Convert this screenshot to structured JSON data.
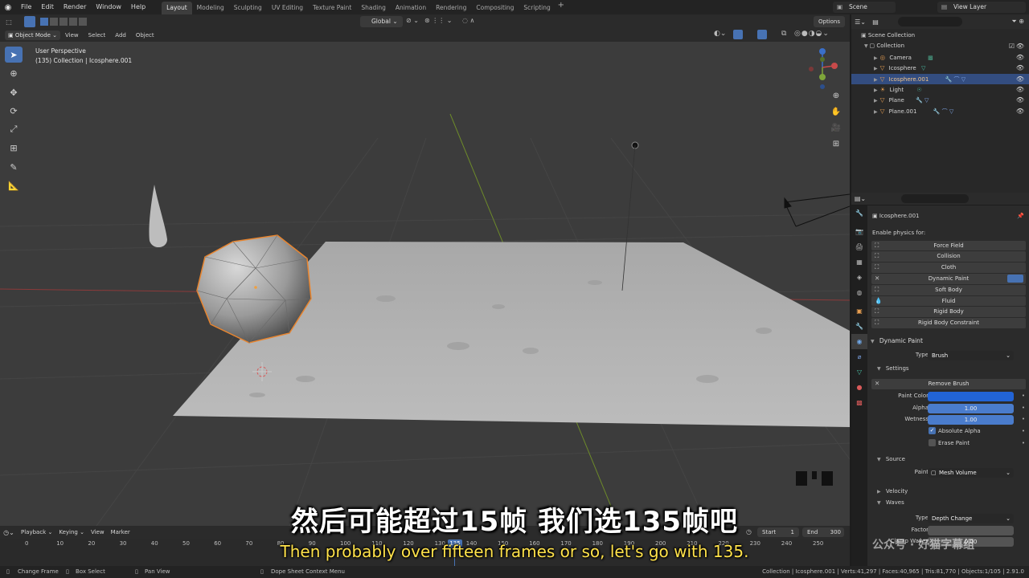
{
  "topbar": {
    "menus": [
      "File",
      "Edit",
      "Render",
      "Window",
      "Help"
    ],
    "workspaces": [
      "Layout",
      "Modeling",
      "Sculpting",
      "UV Editing",
      "Texture Paint",
      "Shading",
      "Animation",
      "Rendering",
      "Compositing",
      "Scripting"
    ],
    "active_workspace": "Layout",
    "scene": "Scene",
    "view_layer": "View Layer"
  },
  "viewport_header": {
    "mode": "Object Mode",
    "menus": [
      "View",
      "Select",
      "Add",
      "Object"
    ],
    "orientation": "Global",
    "options": "Options"
  },
  "viewport": {
    "view_name": "User Perspective",
    "context": "(135) Collection | Icosphere.001"
  },
  "outliner": {
    "root": "Scene Collection",
    "collection": "Collection",
    "items": [
      {
        "name": "Camera",
        "selected": false
      },
      {
        "name": "Icosphere",
        "selected": false
      },
      {
        "name": "Icosphere.001",
        "selected": true
      },
      {
        "name": "Light",
        "selected": false
      },
      {
        "name": "Plane",
        "selected": false
      },
      {
        "name": "Plane.001",
        "selected": false
      }
    ]
  },
  "properties": {
    "object_name": "Icosphere.001",
    "enable_physics_label": "Enable physics for:",
    "physics_buttons": [
      "Force Field",
      "Collision",
      "Cloth",
      "Dynamic Paint",
      "Soft Body",
      "Fluid",
      "Rigid Body",
      "Rigid Body Constraint"
    ],
    "dynamic_paint": {
      "title": "Dynamic Paint",
      "type_label": "Type",
      "type_value": "Brush",
      "settings_title": "Settings",
      "remove_brush": "Remove Brush",
      "paint_color_label": "Paint Color",
      "paint_color": "#2264d6",
      "alpha_label": "Alpha",
      "alpha_value": "1.00",
      "wetness_label": "Wetness",
      "wetness_value": "1.00",
      "absolute_alpha": "Absolute Alpha",
      "erase_paint": "Erase Paint",
      "source_title": "Source",
      "paint_label": "Paint",
      "paint_value": "Mesh Volume",
      "velocity_title": "Velocity",
      "waves_title": "Waves",
      "waves_type_label": "Type",
      "waves_type_value": "Depth Change",
      "factor_label": "Factor",
      "clamp_label": "Clamp Waves",
      "clamp_value": "0.00"
    }
  },
  "timeline": {
    "menus": [
      "Playback",
      "Keying",
      "View",
      "Marker"
    ],
    "start_label": "Start",
    "start_value": "1",
    "end_label": "End",
    "end_value": "300",
    "ticks": [
      "0",
      "10",
      "20",
      "30",
      "40",
      "50",
      "60",
      "70",
      "80",
      "90",
      "100",
      "110",
      "120",
      "130",
      "140",
      "150",
      "160",
      "170",
      "180",
      "190",
      "200",
      "210",
      "220",
      "230",
      "240",
      "250"
    ],
    "current_frame": "135"
  },
  "statusbar": {
    "change_frame": "Change Frame",
    "box_select": "Box Select",
    "pan_view": "Pan View",
    "context_menu": "Dope Sheet Context Menu",
    "stats": "Collection | Icosphere.001 | Verts:41,297 | Faces:40,965 | Tris:81,770 | Objects:1/105 | 2.91.0"
  },
  "subtitles": {
    "chinese": "然后可能超过15帧 我们选135帧吧",
    "english": "Then probably over fifteen frames or so, let's go with 135."
  },
  "watermark": "公众号 · 好猫字幕组"
}
